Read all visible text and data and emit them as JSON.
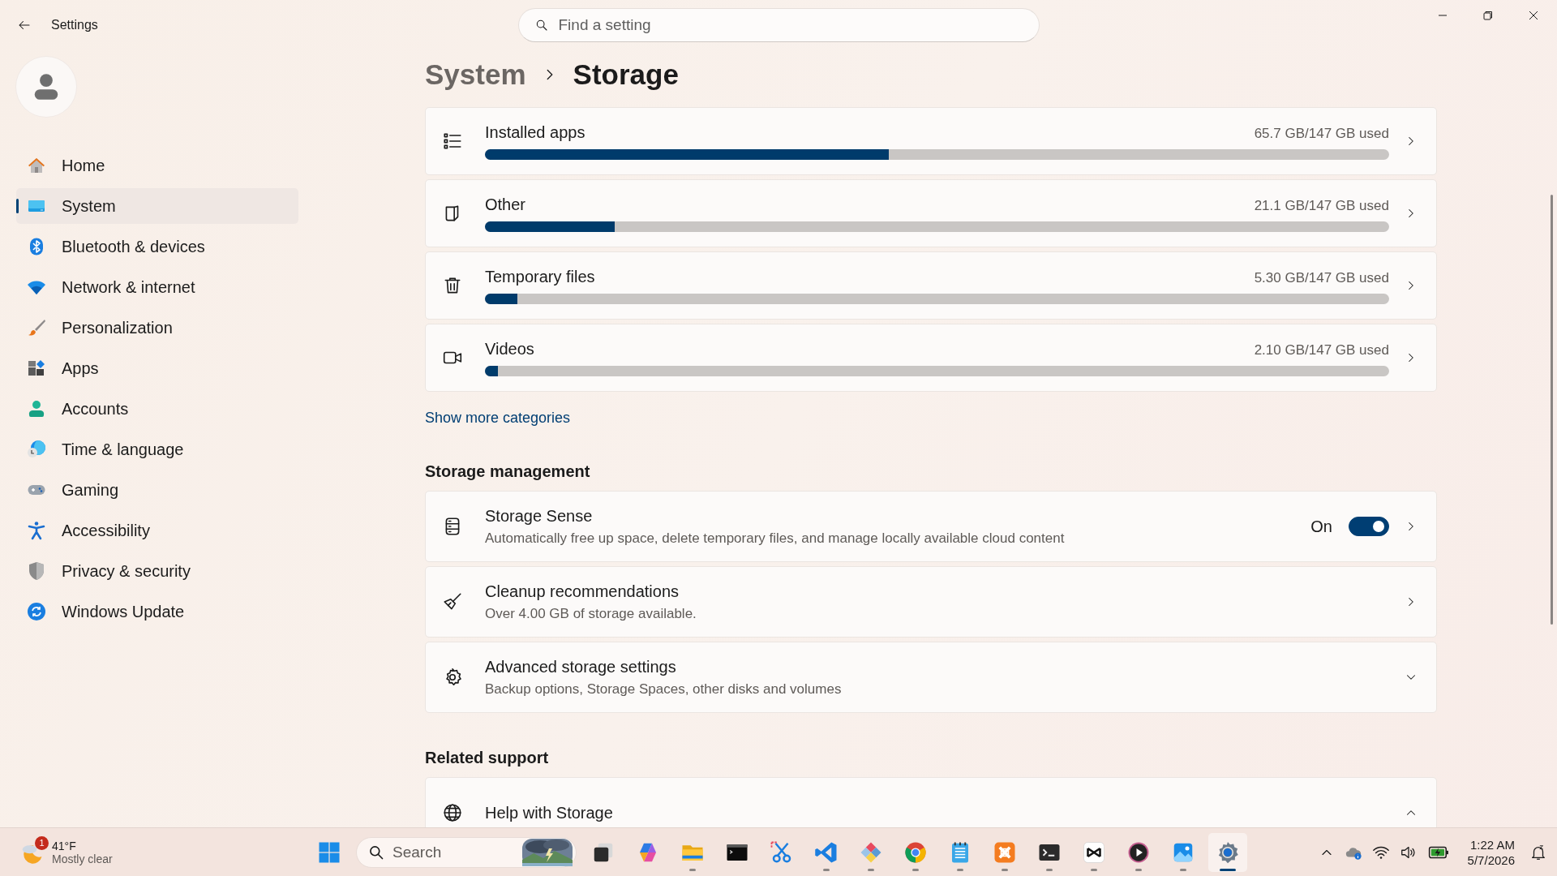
{
  "window": {
    "title": "Settings"
  },
  "search": {
    "placeholder": "Find a setting"
  },
  "breadcrumb": [
    "System",
    "Storage"
  ],
  "sidebar": {
    "items": [
      {
        "label": "Home",
        "selected": false
      },
      {
        "label": "System",
        "selected": true
      },
      {
        "label": "Bluetooth & devices",
        "selected": false
      },
      {
        "label": "Network & internet",
        "selected": false
      },
      {
        "label": "Personalization",
        "selected": false
      },
      {
        "label": "Apps",
        "selected": false
      },
      {
        "label": "Accounts",
        "selected": false
      },
      {
        "label": "Time & language",
        "selected": false
      },
      {
        "label": "Gaming",
        "selected": false
      },
      {
        "label": "Accessibility",
        "selected": false
      },
      {
        "label": "Privacy & security",
        "selected": false
      },
      {
        "label": "Windows Update",
        "selected": false
      }
    ]
  },
  "categories": [
    {
      "name": "Installed apps",
      "reading": "65.7 GB/147 GB used",
      "level": 0.447
    },
    {
      "name": "Other",
      "reading": "21.1 GB/147 GB used",
      "level": 0.1435
    },
    {
      "name": "Temporary files",
      "reading": "5.30 GB/147 GB used",
      "level": 0.036
    },
    {
      "name": "Videos",
      "reading": "2.10 GB/147 GB used",
      "level": 0.014
    }
  ],
  "show_more": "Show more categories",
  "sections": [
    {
      "title": "Storage management",
      "cards": [
        {
          "kind": "toggle",
          "title": "Storage Sense",
          "description": "Automatically free up space, delete temporary files, and manage locally available cloud content",
          "state_label": "On",
          "on": true
        },
        {
          "kind": "link",
          "title": "Cleanup recommendations",
          "description": "Over 4.00 GB of storage available."
        },
        {
          "kind": "expander",
          "title": "Advanced storage settings",
          "description": "Backup options, Storage Spaces, other disks and volumes",
          "expanded": false
        }
      ]
    },
    {
      "title": "Related support",
      "cards": [
        {
          "kind": "expander",
          "title": "Help with Storage",
          "expanded": true
        }
      ]
    }
  ],
  "taskbar": {
    "weather": {
      "badge": "1",
      "temperature": "41°F",
      "condition": "Mostly clear"
    },
    "search": {
      "label": "Search"
    },
    "apps": [
      {
        "running": false,
        "selected": false
      },
      {
        "running": false,
        "selected": false
      },
      {
        "running": true,
        "selected": false
      },
      {
        "running": false,
        "selected": false
      },
      {
        "running": false,
        "selected": false
      },
      {
        "running": true,
        "selected": false
      },
      {
        "running": true,
        "selected": false
      },
      {
        "running": true,
        "selected": false
      },
      {
        "running": true,
        "selected": false
      },
      {
        "running": true,
        "selected": false
      },
      {
        "running": true,
        "selected": false
      },
      {
        "running": true,
        "selected": false
      },
      {
        "running": true,
        "selected": false
      },
      {
        "running": true,
        "selected": false
      },
      {
        "running": true,
        "selected": true
      }
    ],
    "clock": {
      "time": "1:22 AM",
      "date": "5/7/2026"
    }
  }
}
